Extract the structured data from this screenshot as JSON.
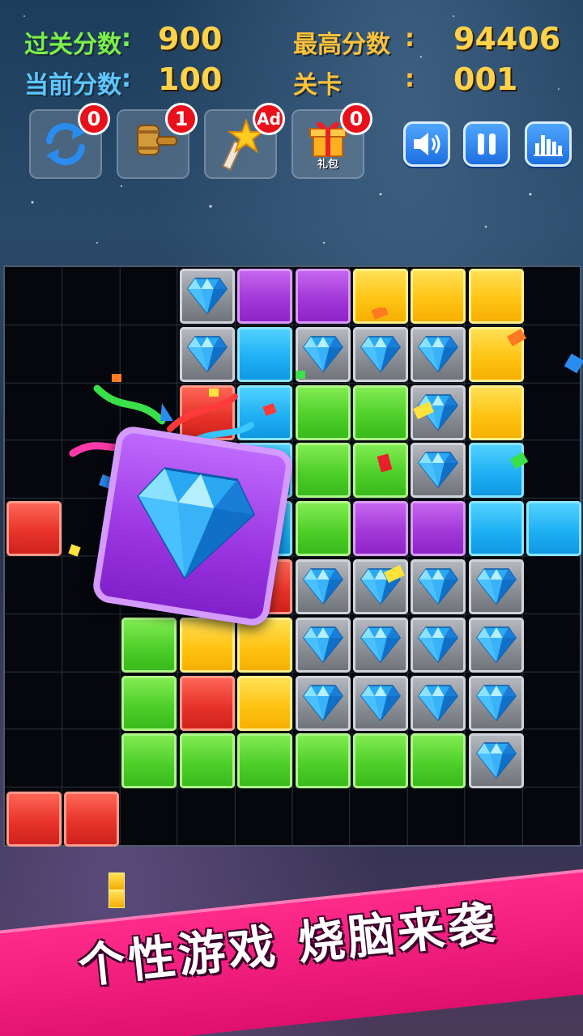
{
  "hud": {
    "level_score_label": "过关分数",
    "level_score_value": "900",
    "current_score_label": "当前分数",
    "current_score_value": "100",
    "high_score_label": "最高分数",
    "high_score_value": "94406",
    "level_label": "关卡",
    "level_value": "001"
  },
  "tools": {
    "refresh": {
      "icon": "refresh-icon",
      "count": "0"
    },
    "hammer": {
      "icon": "hammer-icon",
      "count": "1"
    },
    "magic_wand": {
      "icon": "magic-wand-icon",
      "badge": "Ad"
    },
    "gift": {
      "icon": "gift-icon",
      "count": "0",
      "caption": "礼包"
    }
  },
  "controls": {
    "sound": "speaker-icon",
    "pause": "pause-icon",
    "leaderboard": "bar-chart-icon"
  },
  "board": {
    "columns": 10,
    "rows": 10,
    "rows_data": [
      [
        "",
        "",
        "",
        "gem",
        "purple",
        "purple",
        "yellow",
        "yellow",
        "yellow",
        ""
      ],
      [
        "",
        "",
        "",
        "gem",
        "blue",
        "gem",
        "gem",
        "gem",
        "yellow",
        ""
      ],
      [
        "",
        "",
        "",
        "red",
        "blue",
        "green",
        "green",
        "gem",
        "yellow",
        ""
      ],
      [
        "",
        "",
        "",
        "",
        "blue",
        "green",
        "green",
        "gem",
        "blue",
        ""
      ],
      [
        "red",
        "",
        "",
        "",
        "blue",
        "green",
        "purple",
        "purple",
        "blue",
        "blue"
      ],
      [
        "",
        "",
        "",
        "",
        "red",
        "gem",
        "gem",
        "gem",
        "gem",
        ""
      ],
      [
        "",
        "",
        "green",
        "yellow",
        "yellow",
        "gem",
        "gem",
        "gem",
        "gem",
        ""
      ],
      [
        "",
        "",
        "green",
        "red",
        "yellow",
        "gem",
        "gem",
        "gem",
        "gem",
        ""
      ],
      [
        "",
        "",
        "green",
        "green",
        "green",
        "green",
        "green",
        "green",
        "gem",
        ""
      ],
      [
        "red",
        "red",
        "",
        "",
        "",
        "",
        "",
        "",
        "",
        ""
      ]
    ],
    "colors": {
      "purple": "#a238d8",
      "yellow": "#ffc414",
      "blue": "#1fb0f4",
      "green": "#4fcf2a",
      "red": "#e8342a",
      "gem": "#8a8e95"
    }
  },
  "dragged_piece": {
    "type": "purple-diamond-block",
    "icon": "diamond-icon"
  },
  "banner": {
    "slogan": "个性游戏  烧脑来袭"
  },
  "theme": {
    "accent": "#e0106e",
    "score_color": "#ffd24a"
  }
}
